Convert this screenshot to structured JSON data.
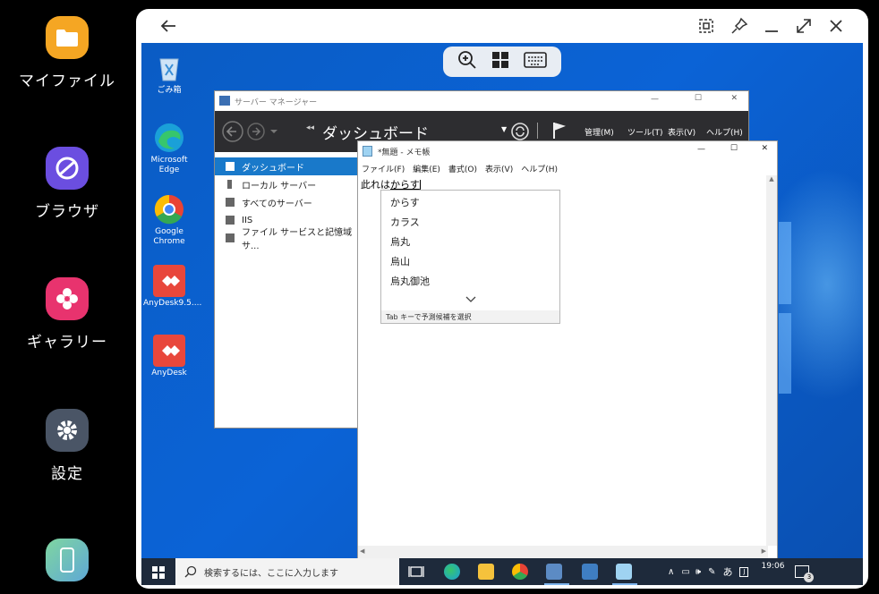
{
  "dock": {
    "apps": [
      {
        "label": "マイファイル",
        "icon": "folder-icon",
        "color": "#f5a623"
      },
      {
        "label": "ブラウザ",
        "icon": "browser-icon",
        "color": "#6b4ee0"
      },
      {
        "label": "ギャラリー",
        "icon": "gallery-icon",
        "color": "#e8336e"
      },
      {
        "label": "設定",
        "icon": "settings-icon",
        "color": "#4a5566"
      },
      {
        "label": "",
        "icon": "phone-icon",
        "color": "#6cc0b3"
      }
    ]
  },
  "frame": {
    "buttons": [
      "back-icon",
      "screenshot-icon",
      "pin-icon",
      "minimize-icon",
      "maximize-icon",
      "close-icon"
    ]
  },
  "remote_toolbar": [
    "zoom-in-icon",
    "windows-icon",
    "keyboard-icon"
  ],
  "desktop_icons": [
    {
      "label": "ごみ箱",
      "icon": "recycle-bin-icon"
    },
    {
      "label": "Microsoft Edge",
      "icon": "edge-icon"
    },
    {
      "label": "Google Chrome",
      "icon": "chrome-icon"
    },
    {
      "label": "AnyDesk9.5....",
      "icon": "anydesk-icon"
    },
    {
      "label": "AnyDesk",
      "icon": "anydesk-icon"
    }
  ],
  "server_manager": {
    "title": "サーバー マネージャー",
    "breadcrumb": "ダッシュボード",
    "menus": [
      "管理(M)",
      "ツール(T)",
      "表示(V)",
      "ヘルプ(H)"
    ],
    "sidebar": [
      "ダッシュボード",
      "ローカル サーバー",
      "すべてのサーバー",
      "IIS",
      "ファイル サービスと記憶域サ..."
    ]
  },
  "notepad": {
    "title": "*無題 - メモ帳",
    "menus": [
      "ファイル(F)",
      "編集(E)",
      "書式(O)",
      "表示(V)",
      "ヘルプ(H)"
    ],
    "text_prefix": "此れは",
    "text_composing": "からす",
    "ime": {
      "candidates": [
        "からす",
        "カラス",
        "烏丸",
        "烏山",
        "烏丸御池"
      ],
      "footer": "Tab キーで予測候補を選択"
    }
  },
  "taskbar": {
    "search_placeholder": "検索するには、ここに入力します",
    "time": "19:06",
    "ime_mode": "あ",
    "notifications": "3"
  }
}
